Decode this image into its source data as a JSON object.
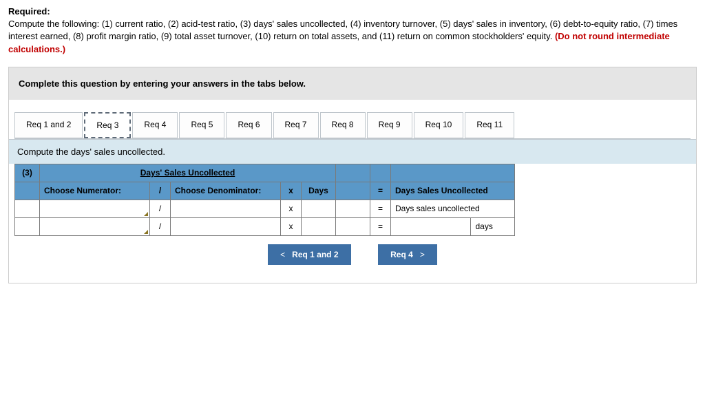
{
  "instructions": {
    "required_label": "Required:",
    "body": "Compute the following: (1) current ratio, (2) acid-test ratio, (3) days' sales uncollected, (4) inventory turnover, (5) days' sales in inventory, (6) debt-to-equity ratio, (7) times interest earned, (8) profit margin ratio, (9) total asset turnover, (10) return on total assets, and (11) return on common stockholders' equity. ",
    "warn": "(Do not round intermediate calculations.)"
  },
  "complete_msg": "Complete this question by entering your answers in the tabs below.",
  "tabs": [
    {
      "label": "Req 1 and 2"
    },
    {
      "label": "Req 3"
    },
    {
      "label": "Req 4"
    },
    {
      "label": "Req 5"
    },
    {
      "label": "Req 6"
    },
    {
      "label": "Req 7"
    },
    {
      "label": "Req 8"
    },
    {
      "label": "Req 9"
    },
    {
      "label": "Req 10"
    },
    {
      "label": "Req 11"
    }
  ],
  "sub_msg": "Compute the days' sales uncollected.",
  "table": {
    "row_num": "(3)",
    "header_title": "Days' Sales Uncollected",
    "choose_num": "Choose Numerator:",
    "choose_den": "Choose Denominator:",
    "slash": "/",
    "x_sym": "x",
    "days_label": "Days",
    "eq": "=",
    "result_header": "Days Sales Uncollected",
    "result_text": "Days sales uncollected",
    "days_unit": "days"
  },
  "nav": {
    "prev_chev": "<",
    "prev_label": "Req 1 and 2",
    "next_label": "Req 4",
    "next_chev": ">"
  }
}
